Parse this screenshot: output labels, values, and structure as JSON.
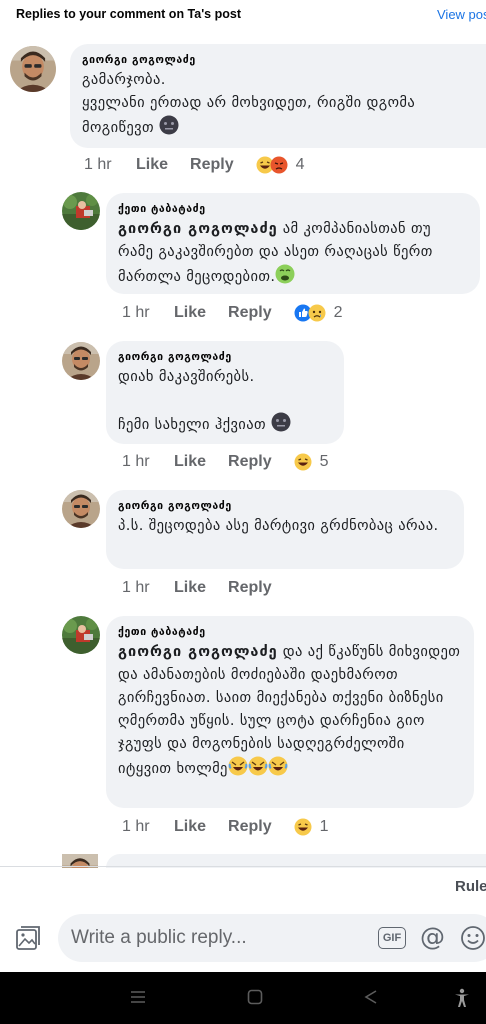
{
  "header": {
    "title": "Replies to your comment on Ta's post",
    "view_post": "View pos"
  },
  "comments": [
    {
      "author": "გიორგი გოგოლაძე",
      "text": "გამარჯობა.\nყველანი ერთად არ მოხვიდეთ, რიგში დგომა მოგიწევთ",
      "time": "1 hr",
      "like": "Like",
      "reply": "Reply",
      "reaction_count": "4",
      "reactions": [
        "haha",
        "angry"
      ]
    },
    {
      "author": "ქეთი ტაბატაძე",
      "mention": "გიორგი გოგოლაძე",
      "text": "  ამ კომპანიასთან თუ რამე გაკავშირებთ და ასეთ რაღაცას წერთ მართლა მეცოდებით.",
      "time": "1 hr",
      "like": "Like",
      "reply": "Reply",
      "reaction_count": "2",
      "reactions": [
        "like",
        "sad"
      ]
    },
    {
      "author": "გიორგი გოგოლაძე",
      "text": "დიახ მაკავშირებს.\n\nჩემი სახელი ჰქვიათ",
      "time": "1 hr",
      "like": "Like",
      "reply": "Reply",
      "reaction_count": "5",
      "reactions": [
        "haha"
      ]
    },
    {
      "author": "გიორგი გოგოლაძე",
      "text": "პ.ს. შეცოდება ასე მარტივი გრძნობაც არაა.",
      "time": "1 hr",
      "like": "Like",
      "reply": "Reply",
      "reaction_count": "",
      "reactions": []
    },
    {
      "author": "ქეთი ტაბატაძე",
      "mention": "გიორგი გოგოლაძე",
      "text": " და აქ წკაწუნს მიხვიდეთ და ამანათების მოძიებაში დაეხმაროთ გირჩევნიათ. საით მიექანება თქვენი ბიზნესი ღმერთმა უწყის. სულ ცოტა დარჩენია გიო ჯგუფს და მოგონების სადღეგრძელოში იტყვით ხოლმე",
      "time": "1 hr",
      "like": "Like",
      "reply": "Reply",
      "reaction_count": "1",
      "reactions": [
        "haha"
      ]
    }
  ],
  "footer": {
    "rules": "Rule",
    "reply_placeholder": "Write a public reply...",
    "gif_label": "GIF",
    "at_label": "@"
  },
  "icons": {
    "photo": "photo-icon",
    "gif": "gif-icon",
    "mention": "at-icon",
    "emoji": "smile-icon",
    "nav": [
      "recent-apps-icon",
      "home-icon",
      "back-icon",
      "accessibility-icon"
    ]
  },
  "colors": {
    "bubble": "#f0f2f5",
    "accent": "#1b74e4",
    "secondary_text": "#65676b",
    "navbar": "#000000"
  }
}
